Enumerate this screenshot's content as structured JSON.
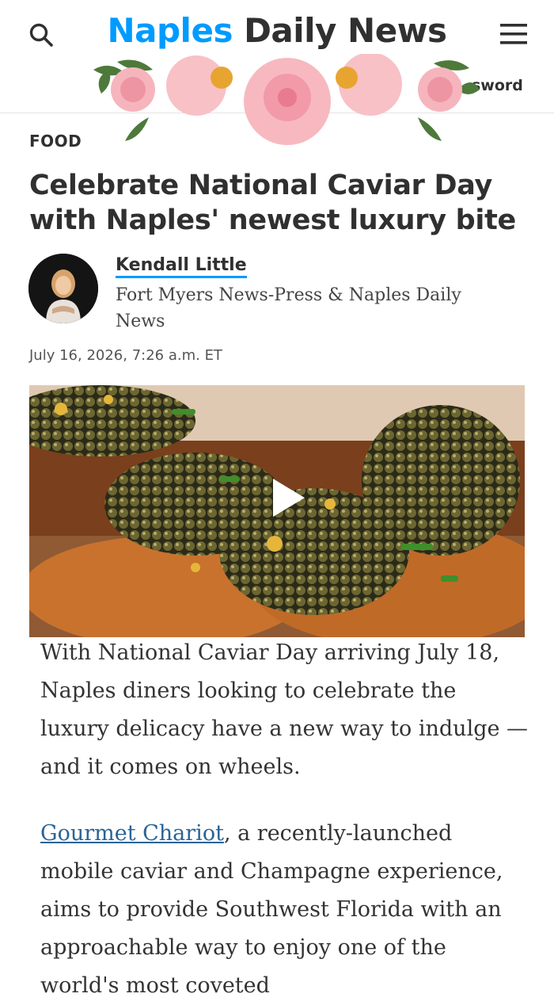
{
  "header": {
    "logo_brand": "Naples",
    "logo_rest": "Daily News",
    "search_icon": "search-icon",
    "menu_icon": "hamburger-menu-icon",
    "signin_partial": "sword",
    "brand_color": "#009bff"
  },
  "article": {
    "section": "FOOD",
    "headline": "Celebrate National Caviar Day with Naples' newest luxury bite",
    "author": {
      "name": "Kendall Little",
      "org": "Fort Myers News-Press & Naples Daily News"
    },
    "dateline": "July 16, 2026, 7:26 a.m. ET",
    "hero": {
      "icon": "play-icon"
    },
    "paragraphs": {
      "p1": "With National Caviar Day arriving July 18, Naples diners looking to celebrate the luxury delicacy have a new way to indulge — and it comes on wheels.",
      "p2_link": "Gourmet Chariot",
      "p2_rest": ", a recently-launched mobile caviar and Champagne experience, aims to provide Southwest Florida with an approachable way to enjoy one of the world's most coveted"
    }
  }
}
